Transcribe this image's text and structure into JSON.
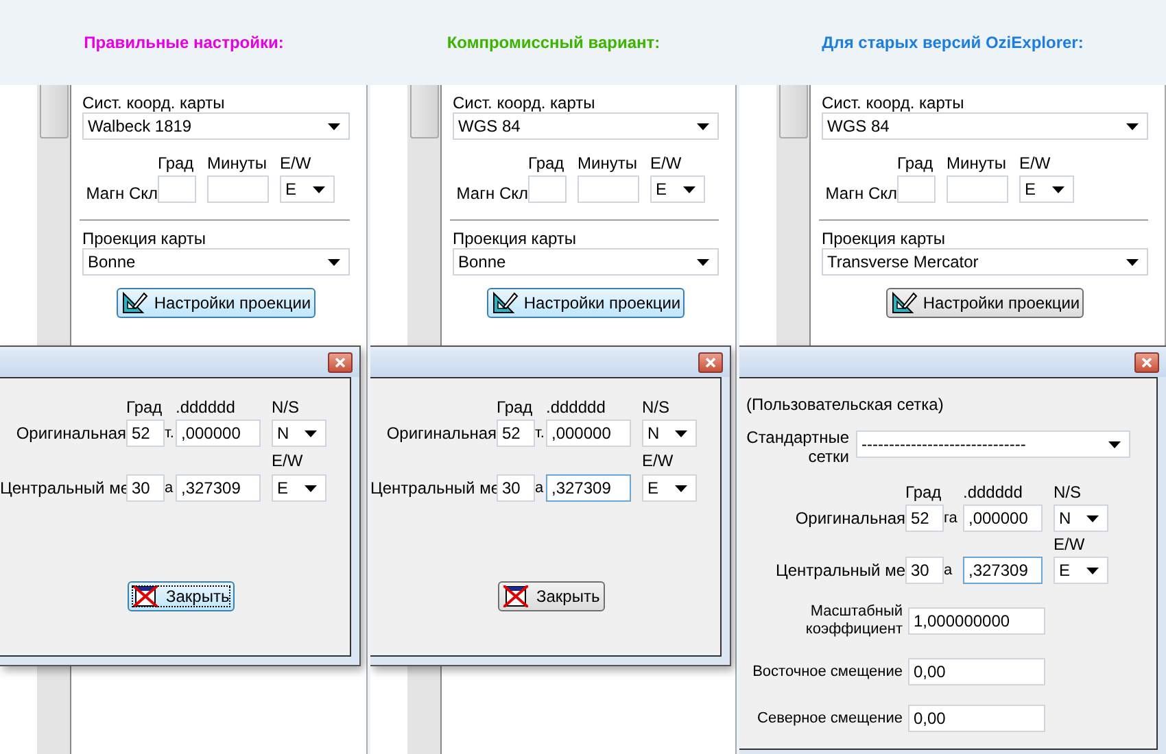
{
  "panels": [
    {
      "title": "Правильные настройки:",
      "color": "#e600e6",
      "map_settings": {
        "datum_label": "Сист. коорд. карты",
        "datum": "Walbeck 1819",
        "magn_headers": [
          "Град",
          "Минуты",
          "E/W"
        ],
        "magn_label": "Магн Скл",
        "magn_ew": "E",
        "projection_label": "Проекция карты",
        "projection": "Bonne",
        "projection_button": {
          "label": "Настройки проекции",
          "focused": true
        }
      },
      "dialog": {
        "headers": [
          "Град",
          ".dddddd",
          "N/S"
        ],
        "origin": {
          "label": "Оригинальная",
          "tail": "т.",
          "deg": "52",
          "dec": ",000000",
          "dec_focused": false,
          "hemisphere": "N"
        },
        "ew_header": "E/W",
        "central": {
          "label": "Центральный ме",
          "tail": "а",
          "deg": "30",
          "dec": ",327309",
          "dec_focused": false,
          "hemisphere": "E"
        },
        "close_button": {
          "label": "Закрыть",
          "focused": true
        }
      }
    },
    {
      "title": "Компромиссный вариант:",
      "color": "#3cb400",
      "map_settings": {
        "datum_label": "Сист. коорд. карты",
        "datum": "WGS 84",
        "magn_headers": [
          "Град",
          "Минуты",
          "E/W"
        ],
        "magn_label": "Магн Скл",
        "magn_ew": "E",
        "projection_label": "Проекция карты",
        "projection": "Bonne",
        "projection_button": {
          "label": "Настройки проекции",
          "focused": true
        }
      },
      "dialog": {
        "headers": [
          "Град",
          ".dddddd",
          "N/S"
        ],
        "origin": {
          "label": "Оригинальная",
          "tail": "т.",
          "deg": "52",
          "dec": ",000000",
          "dec_focused": false,
          "hemisphere": "N"
        },
        "ew_header": "E/W",
        "central": {
          "label": "Центральный ме",
          "tail": "а",
          "deg": "30",
          "dec": ",327309",
          "dec_focused": true,
          "hemisphere": "E"
        },
        "close_button": {
          "label": "Закрыть",
          "focused": false
        }
      }
    },
    {
      "title": "Для старых версий OziExplorer:",
      "color": "#1e7ee0",
      "map_settings": {
        "datum_label": "Сист. коорд. карты",
        "datum": "WGS 84",
        "magn_headers": [
          "Град",
          "Минуты",
          "E/W"
        ],
        "magn_label": "Магн Скл",
        "magn_ew": "E",
        "projection_label": "Проекция карты",
        "projection": "Transverse Mercator",
        "projection_button": {
          "label": "Настройки проекции",
          "focused": false
        }
      },
      "dialog": {
        "grid_name": "(Пользовательская сетка)",
        "standard_grids": {
          "label": "Стандартные сетки",
          "value": "------------------------------"
        },
        "headers": [
          "Град",
          ".dddddd",
          "N/S"
        ],
        "origin": {
          "label": "Оригинальная",
          "tail": "га",
          "deg": "52",
          "dec": ",000000",
          "dec_focused": false,
          "hemisphere": "N"
        },
        "ew_header": "E/W",
        "central": {
          "label": "Центральный ме",
          "tail": "а",
          "deg": "30",
          "dec": ",327309",
          "dec_focused": true,
          "hemisphere": "E"
        },
        "fields": [
          {
            "label": "Масштабный коэффициент",
            "value": "1,000000000"
          },
          {
            "label": "Восточное смещение",
            "value": "0,00"
          },
          {
            "label": "Северное смещение",
            "value": "0,00"
          }
        ]
      }
    }
  ]
}
